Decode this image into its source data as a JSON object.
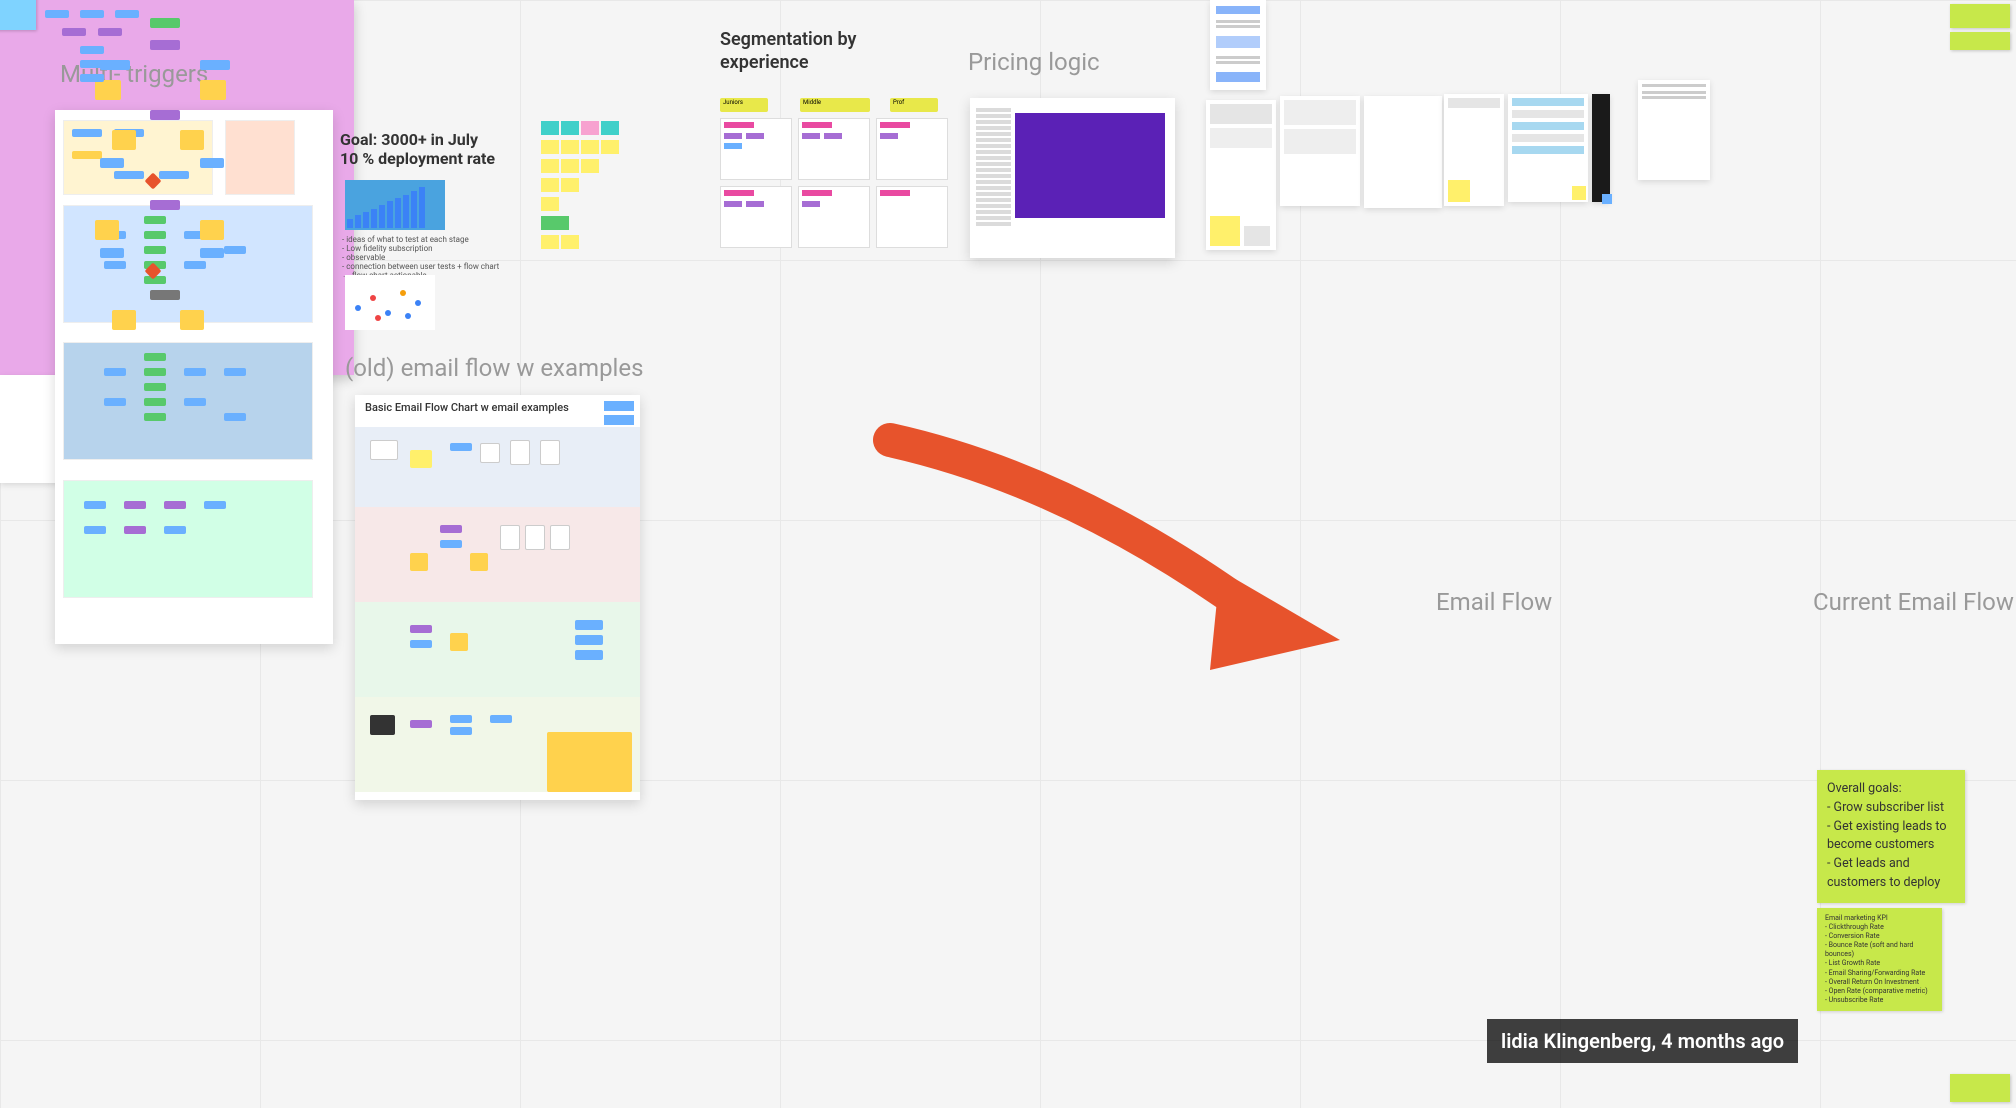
{
  "sections": {
    "multi_triggers": {
      "title": "Multi- triggers"
    },
    "goal": {
      "line1": "Goal: 3000+ in July",
      "line2": "10 % deployment rate",
      "notes": "- ideas of what to test at each stage\n- Low fidelity subscription\n- observable\n- connection between user tests + flow chart → flow chart actionable"
    },
    "segmentation": {
      "title": "Segmentation by experience"
    },
    "pricing": {
      "title": "Pricing logic"
    },
    "old_flow": {
      "title": "(old) email flow w examples",
      "frame_title": "Basic Email Flow Chart w email examples"
    },
    "email_flow": {
      "title": "Email Flow",
      "caption": "lidia Klingenberg, 4 months ago"
    },
    "current_flow": {
      "title": "Current Email Flow"
    },
    "goals_note": {
      "heading": "Overall goals:",
      "b1": "- Grow subscriber list",
      "b2": "- Get existing leads to become customers",
      "b3": "- Get leads and customers to deploy"
    },
    "kpi_note": {
      "heading": "Email marketing KPI",
      "i1": "- Clickthrough Rate",
      "i2": "- Conversion Rate",
      "i3": "- Bounce Rate (soft and hard bounces)",
      "i4": "- List Growth Rate",
      "i5": "- Email Sharing/Forwarding Rate",
      "i6": "- Overall Return On Investment",
      "i7": "- Open Rate (comparative metric)",
      "i8": "- Unsubscribe Rate"
    },
    "seg_groups": {
      "g1": "Juniors",
      "g2": "Middle",
      "g3": "Prof"
    }
  }
}
